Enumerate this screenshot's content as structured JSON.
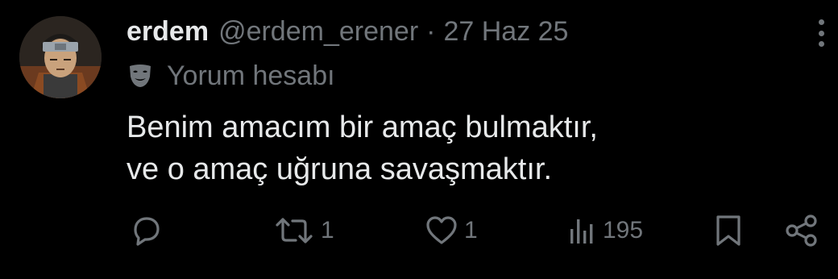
{
  "tweet": {
    "author_name": "erdem",
    "author_handle": "@erdem_erener",
    "separator": "·",
    "date": "27 Haz 25",
    "label_icon": "mask-icon",
    "label_text": "Yorum hesabı",
    "text_lines": [
      "Benim amacım bir amaç bulmaktır,",
      "ve o amaç uğruna savaşmaktır."
    ]
  },
  "actions": {
    "reply": {
      "icon": "reply-icon",
      "count": ""
    },
    "retweet": {
      "icon": "retweet-icon",
      "count": "1"
    },
    "like": {
      "icon": "heart-icon",
      "count": "1"
    },
    "views": {
      "icon": "views-icon",
      "count": "195"
    },
    "bookmark": {
      "icon": "bookmark-icon"
    },
    "share": {
      "icon": "share-icon"
    }
  },
  "colors": {
    "background": "#000000",
    "primary_text": "#e7e9ea",
    "secondary_text": "#71767b"
  }
}
